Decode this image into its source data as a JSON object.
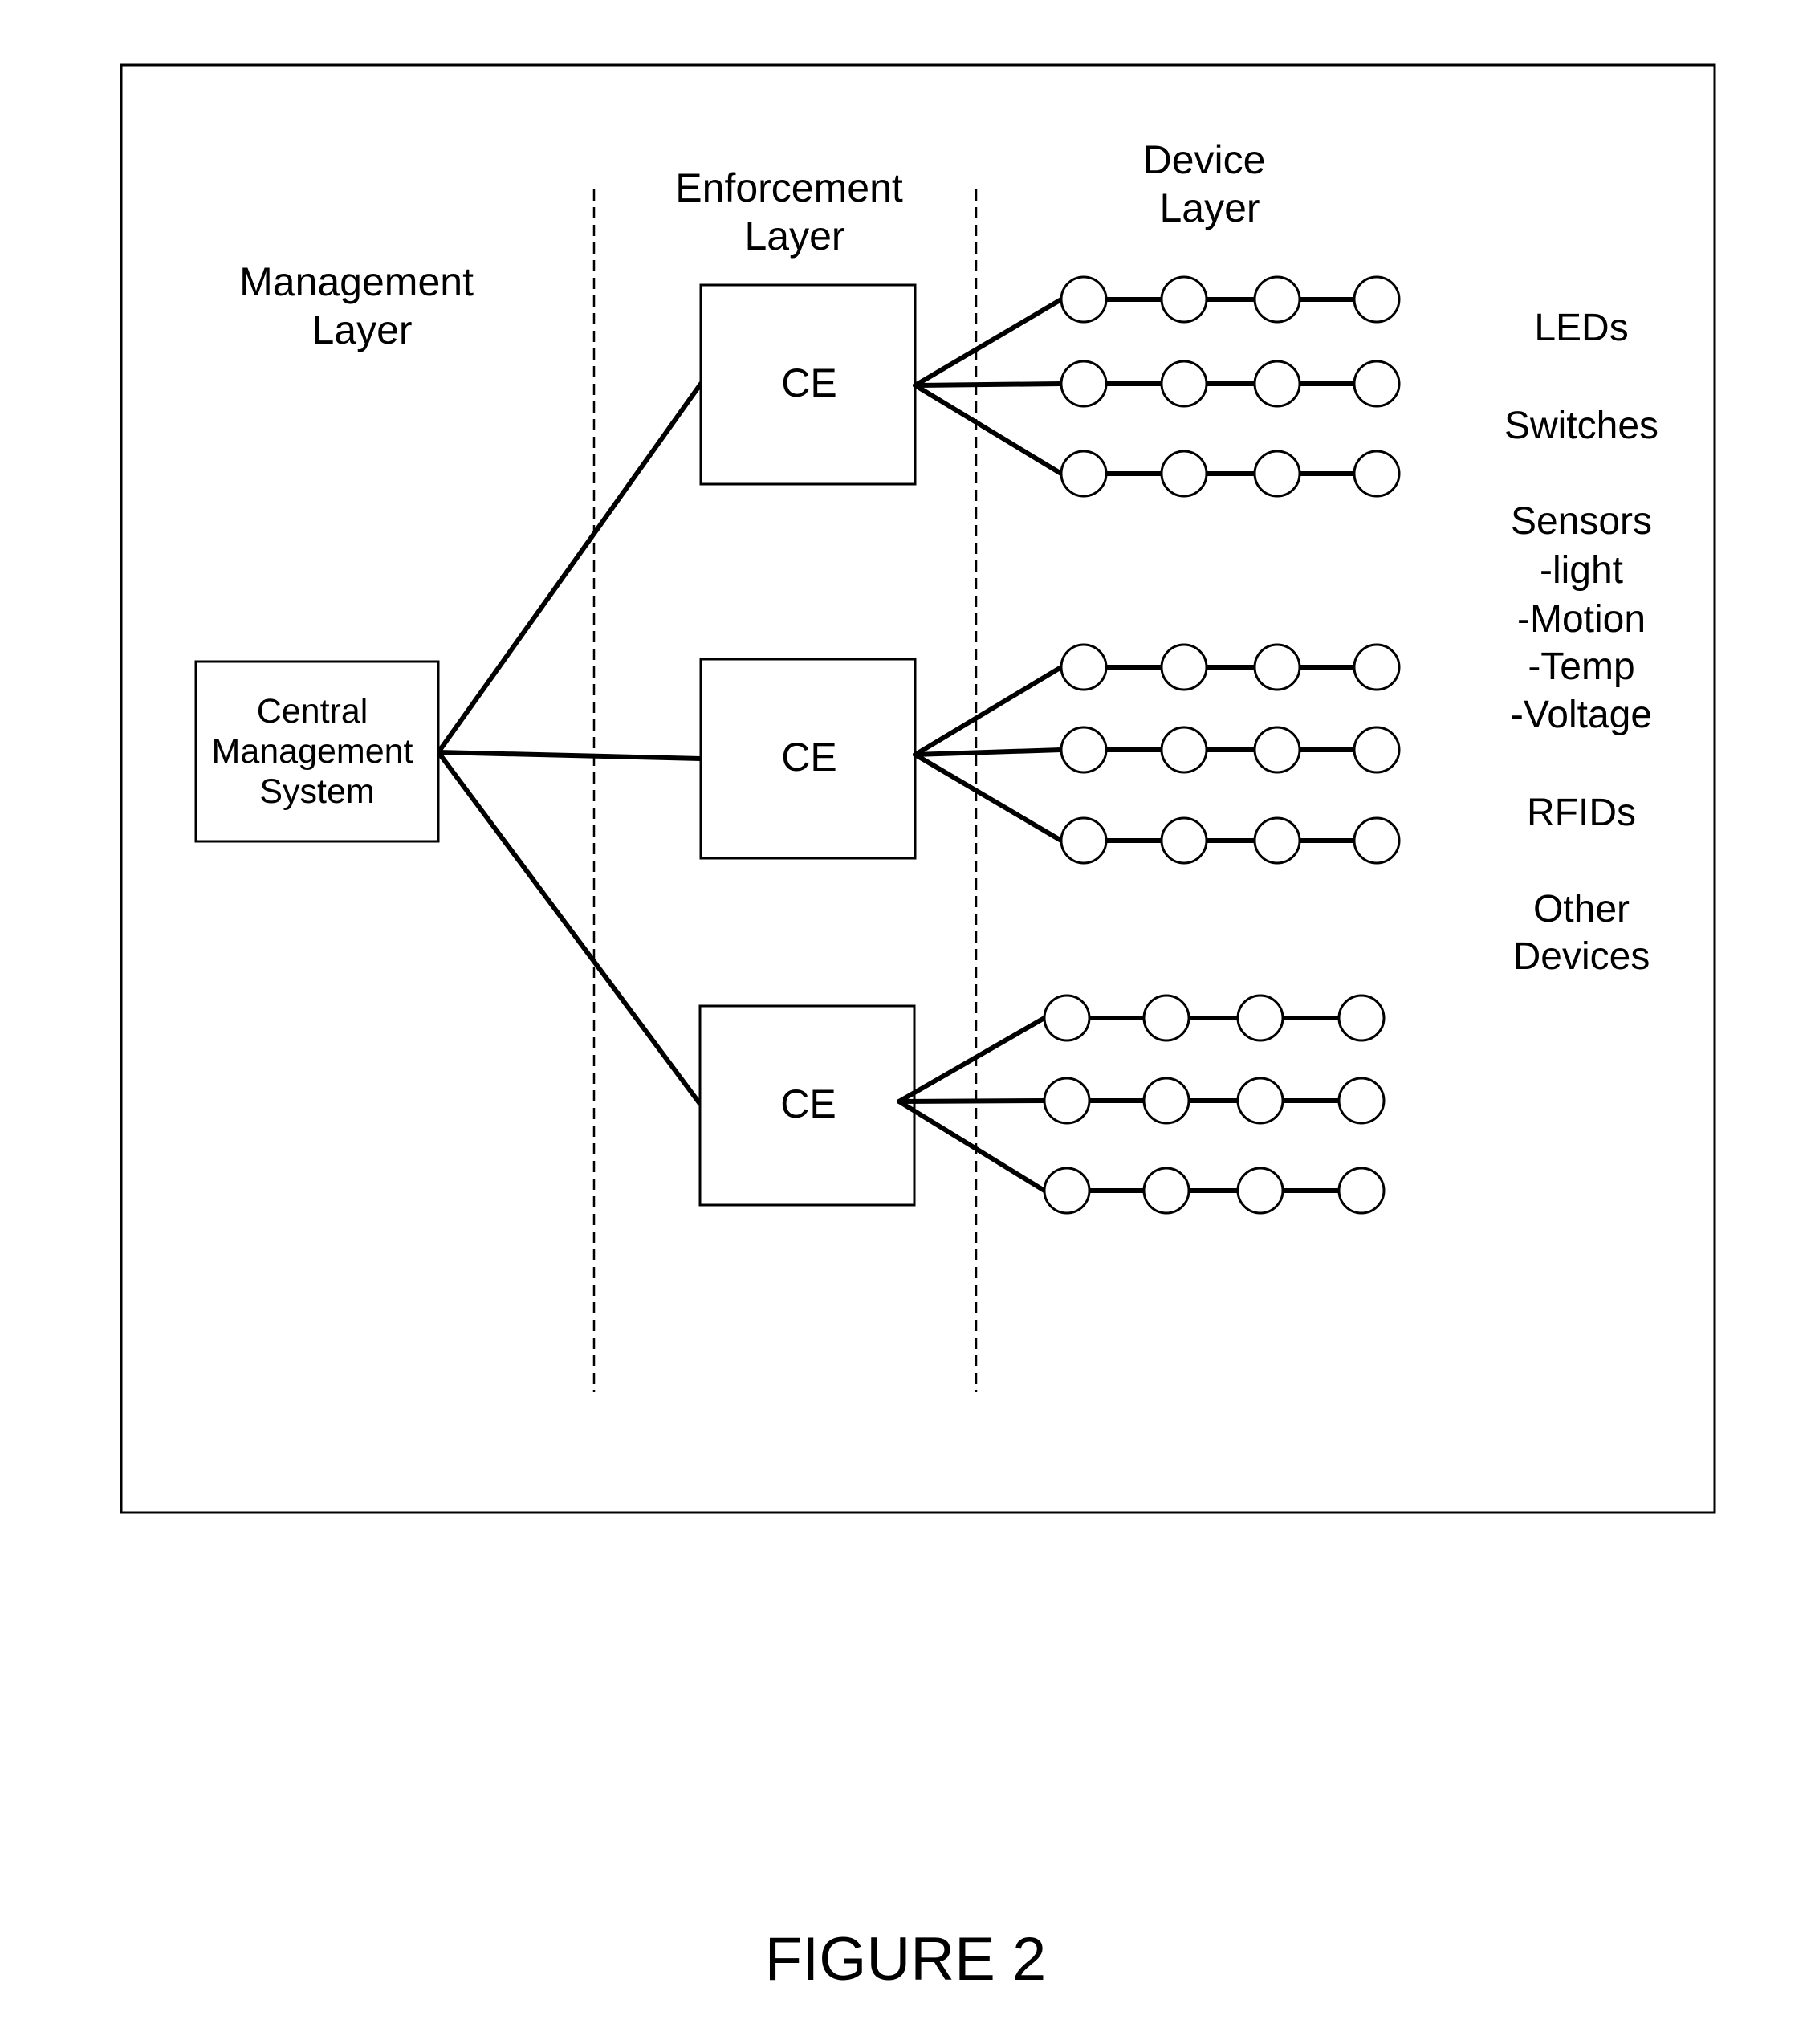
{
  "layers": {
    "management": [
      "Management",
      "Layer"
    ],
    "enforcement": [
      "Enforcement",
      "Layer"
    ],
    "device": [
      "Device",
      "Layer"
    ]
  },
  "central_management_system": {
    "label_lines": [
      "Central",
      "Management",
      "System"
    ]
  },
  "enforcement_nodes": [
    {
      "label": "CE",
      "device_chains": 3,
      "devices_per_chain": 4
    },
    {
      "label": "CE",
      "device_chains": 3,
      "devices_per_chain": 4
    },
    {
      "label": "CE",
      "device_chains": 3,
      "devices_per_chain": 4
    }
  ],
  "device_categories": [
    {
      "lines": [
        "LEDs"
      ]
    },
    {
      "lines": [
        "Switches"
      ]
    },
    {
      "lines": [
        "Sensors",
        "-light",
        "-Motion",
        "-Temp",
        "-Voltage"
      ]
    },
    {
      "lines": [
        "RFIDs"
      ]
    },
    {
      "lines": [
        "Other",
        "Devices"
      ]
    }
  ],
  "caption": "FIGURE 2"
}
